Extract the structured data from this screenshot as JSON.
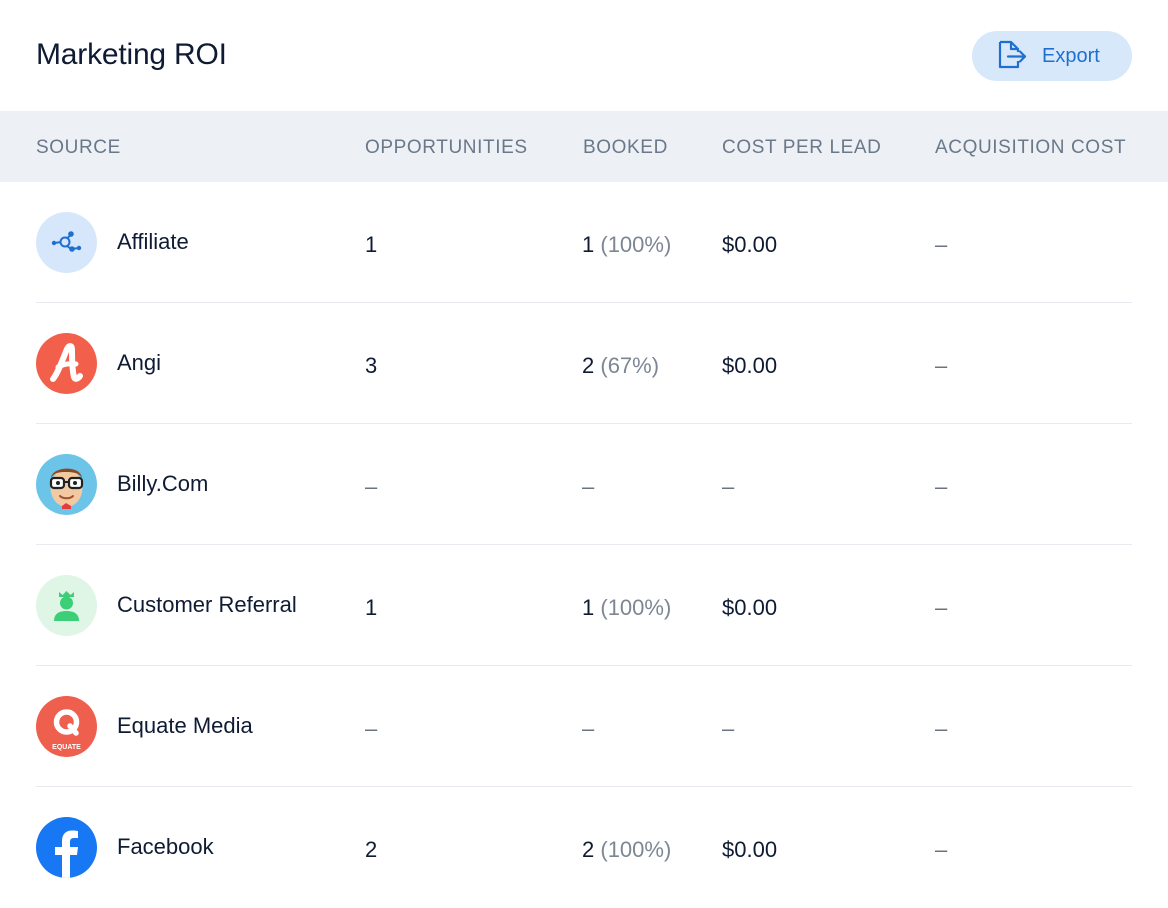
{
  "header": {
    "title": "Marketing ROI",
    "export_label": "Export"
  },
  "columns": {
    "source": "SOURCE",
    "opportunities": "OPPORTUNITIES",
    "booked": "BOOKED",
    "cost_per_lead": "COST PER LEAD",
    "acquisition_cost": "ACQUISITION COST"
  },
  "rows": [
    {
      "source": "Affiliate",
      "icon": "affiliate-network-icon",
      "opportunities": "1",
      "booked": "1",
      "booked_pct": "(100%)",
      "cost_per_lead": "$0.00",
      "acquisition_cost": "–"
    },
    {
      "source": "Angi",
      "icon": "angi-logo-icon",
      "opportunities": "3",
      "booked": "2",
      "booked_pct": "(67%)",
      "cost_per_lead": "$0.00",
      "acquisition_cost": "–"
    },
    {
      "source": "Billy.Com",
      "icon": "billy-com-logo-icon",
      "opportunities": "–",
      "booked": "–",
      "booked_pct": "",
      "cost_per_lead": "–",
      "acquisition_cost": "–"
    },
    {
      "source": "Customer Referral",
      "icon": "customer-referral-icon",
      "opportunities": "1",
      "booked": "1",
      "booked_pct": "(100%)",
      "cost_per_lead": "$0.00",
      "acquisition_cost": "–"
    },
    {
      "source": "Equate Media",
      "icon": "equate-media-logo-icon",
      "opportunities": "–",
      "booked": "–",
      "booked_pct": "",
      "cost_per_lead": "–",
      "acquisition_cost": "–"
    },
    {
      "source": "Facebook",
      "icon": "facebook-logo-icon",
      "opportunities": "2",
      "booked": "2",
      "booked_pct": "(100%)",
      "cost_per_lead": "$0.00",
      "acquisition_cost": "–"
    }
  ],
  "logo_text": {
    "equate": "EQUATE"
  },
  "colors": {
    "accent": "#1f6fd1",
    "export_bg": "#d8e8fb",
    "header_bg": "#edf1f5",
    "angi": "#f2604c",
    "equate": "#ef5f4e",
    "facebook": "#1877f2",
    "referral_bg": "#dff5e6",
    "referral": "#3ccf78"
  }
}
